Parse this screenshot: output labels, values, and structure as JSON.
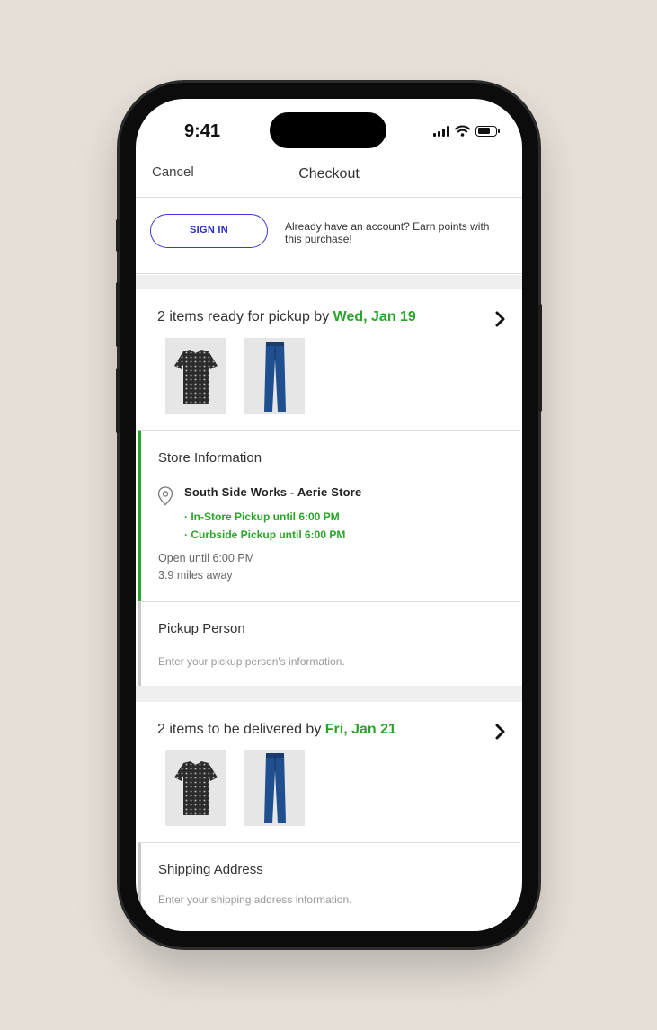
{
  "status_bar": {
    "time": "9:41",
    "icons": [
      "signal-icon",
      "wifi-icon",
      "battery-icon"
    ]
  },
  "nav": {
    "cancel_label": "Cancel",
    "title": "Checkout"
  },
  "signin": {
    "button_label": "SIGN IN",
    "message": "Already have an account? Earn points with this purchase!"
  },
  "pickup": {
    "heading_prefix": "2 items ready for pickup by ",
    "date": "Wed, Jan 19",
    "products": [
      "black-patterned-top",
      "blue-jeans"
    ],
    "store_info": {
      "title": "Store Information",
      "store_name": "South Side Works - Aerie Store",
      "options": [
        "· In-Store Pickup until 6:00 PM",
        "· Curbside Pickup until 6:00 PM"
      ],
      "open_hours": "Open until 6:00 PM",
      "distance": "3.9 miles away"
    },
    "pickup_person": {
      "title": "Pickup Person",
      "placeholder": "Enter your pickup person's information."
    }
  },
  "delivery": {
    "heading_prefix": "2 items to be delivered by ",
    "date": "Fri, Jan 21",
    "products": [
      "black-patterned-top",
      "blue-jeans"
    ],
    "shipping": {
      "title": "Shipping Address",
      "placeholder": "Enter your shipping address information."
    }
  },
  "colors": {
    "accent_green": "#2aa52a",
    "signin_blue": "#2a2ac8",
    "background": "#e6e0d8"
  }
}
